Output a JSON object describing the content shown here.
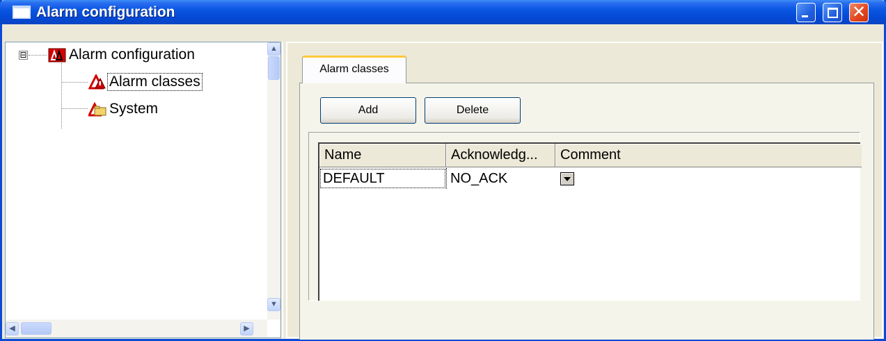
{
  "window": {
    "title": "Alarm configuration"
  },
  "tree": {
    "root": {
      "label": "Alarm configuration",
      "expander": "⊟"
    },
    "children": [
      {
        "label": "Alarm classes",
        "selected": true
      },
      {
        "label": "System",
        "selected": false
      }
    ]
  },
  "tabs": [
    {
      "label": "Alarm classes",
      "active": true
    }
  ],
  "toolbar": {
    "add_label": "Add",
    "delete_label": "Delete"
  },
  "grid": {
    "columns": [
      "Name",
      "Acknowledg...",
      "Comment"
    ],
    "rows": [
      {
        "name": "DEFAULT",
        "acknowledge": "NO_ACK",
        "comment": ""
      }
    ]
  },
  "colors": {
    "titlebar": "#0548d4",
    "accent_tab": "#ffc83c",
    "alarm_red": "#d40000"
  },
  "icons": [
    "window-icon",
    "minimize-icon",
    "maximize-icon",
    "close-icon",
    "alarm-icon",
    "folder-icon",
    "scroll-up-icon",
    "scroll-down-icon",
    "scroll-left-icon",
    "scroll-right-icon",
    "dropdown-icon"
  ]
}
